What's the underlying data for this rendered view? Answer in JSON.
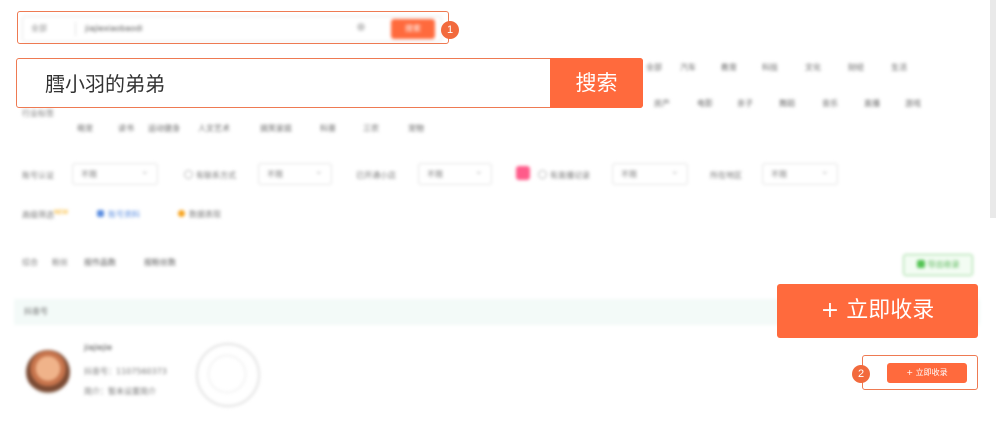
{
  "search": {
    "scope": "全部",
    "value": "膤小羽的弟弟",
    "query_small": "jiajiexiaobaodi",
    "button": "搜索"
  },
  "categories": {
    "label_prefix": "行业标签",
    "row1": [
      "全部",
      "汽车",
      "教育",
      "科技",
      "文化",
      "财经",
      "生活"
    ],
    "row2": [
      "房产",
      "电影",
      "亲子",
      "舞蹈",
      "音乐",
      "直播",
      "游戏"
    ],
    "row3": [
      "萌宠",
      "读书",
      "运动健身",
      "人文艺术",
      "搞笑家庭",
      "科普",
      "三农",
      "宠物"
    ]
  },
  "filters": {
    "account_auth": {
      "label": "账号认证",
      "value": "不限"
    },
    "contact": {
      "label": "有联系方式",
      "value": "不限"
    },
    "shop": {
      "label": "已开通小店",
      "value": "不限"
    },
    "live": {
      "label": "有直播记录",
      "value": "不限"
    },
    "region": {
      "label": "所在地区",
      "value": "不限"
    },
    "advanced": {
      "label": "高级筛选",
      "badge": "NEW"
    },
    "opt1": "账号资料",
    "opt2": "数据表现"
  },
  "sort": {
    "items": [
      "综合",
      "粉丝",
      "按作品数",
      "按粉丝数"
    ],
    "export_button": "导出收录"
  },
  "table": {
    "header": "抖音号",
    "row": {
      "name": "jiajiejie",
      "account_id": "抖音号：1107560373",
      "intro": "简介：暂未设置简介",
      "collect_label": "+ 立即收录"
    }
  },
  "callouts": {
    "badge1": "1",
    "badge2": "2",
    "zoom_collect": "+ 立即收录"
  }
}
